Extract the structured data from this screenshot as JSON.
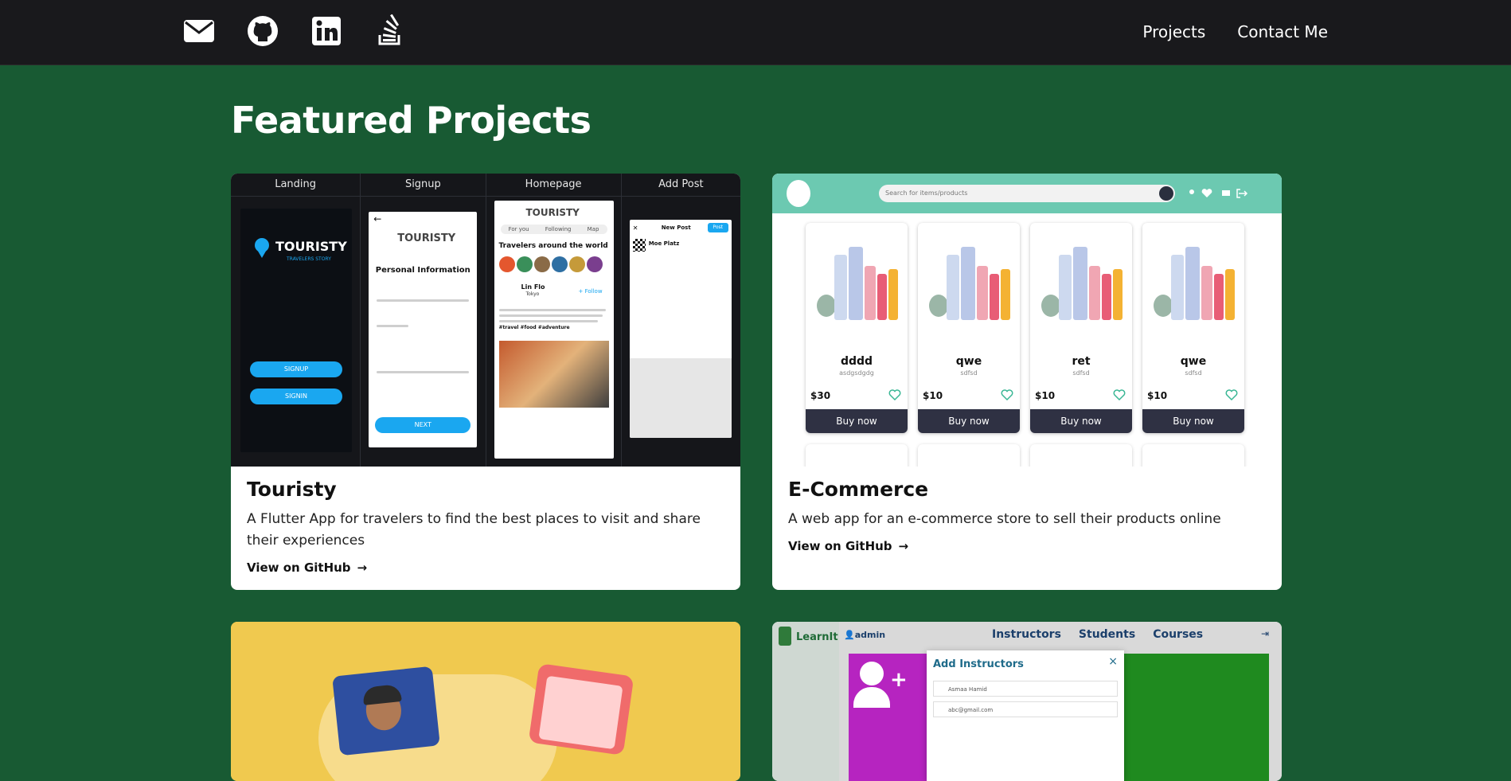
{
  "nav": {
    "icons": [
      "mail-icon",
      "github-icon",
      "linkedin-icon",
      "stackoverflow-icon"
    ],
    "links": [
      "Projects",
      "Contact Me"
    ]
  },
  "page_title": "Featured Projects",
  "projects": [
    {
      "title": "Touristy",
      "description": "A Flutter App for travelers to find the best places to visit and share their experiences",
      "link": "View on GitHub",
      "preview": {
        "columns": [
          "Landing",
          "Signup",
          "Homepage",
          "Add Post"
        ],
        "app_name": "TOURISTY",
        "tagline": "TRAVELERS STORY",
        "signup_button": "SIGNUP",
        "signin_button": "SIGNIN",
        "personal_info": "Personal Information",
        "next_button": "NEXT",
        "tab_for_you": "For you",
        "tab_following": "Following",
        "tab_map": "Map",
        "section": "Travelers around the world",
        "post_author": "Lin Flo",
        "post_location": "Tokyo",
        "follow": "+ Follow",
        "post_hashtags": "#travel #food #adventure",
        "new_post": "New Post",
        "post_button": "Post",
        "poster": "Moe Platz"
      }
    },
    {
      "title": "E-Commerce",
      "description": "A web app for an e-commerce store to sell their products online",
      "link": "View on GitHub",
      "preview": {
        "search_placeholder": "Search for items/products",
        "products": [
          {
            "name": "dddd",
            "sub": "asdgsdgdg",
            "price": "$30",
            "buy": "Buy now"
          },
          {
            "name": "qwe",
            "sub": "sdfsd",
            "price": "$10",
            "buy": "Buy now"
          },
          {
            "name": "ret",
            "sub": "sdfsd",
            "price": "$10",
            "buy": "Buy now"
          },
          {
            "name": "qwe",
            "sub": "sdfsd",
            "price": "$10",
            "buy": "Buy now"
          }
        ]
      }
    },
    {
      "title": "",
      "preview": {}
    },
    {
      "title": "",
      "preview": {
        "brand": "LearnIt",
        "user": "admin",
        "nav": [
          "Instructors",
          "Students",
          "Courses"
        ],
        "modal_title": "Add Instructors",
        "field_name": "Asmaa Hamid",
        "field_email": "abc@gmail.com"
      }
    }
  ],
  "colors": {
    "background": "#185a33",
    "topbar": "#19191c",
    "accent_blue": "#1aa7f0",
    "ecommerce_bar": "#6cc9b1",
    "buy_button": "#2f3143"
  }
}
